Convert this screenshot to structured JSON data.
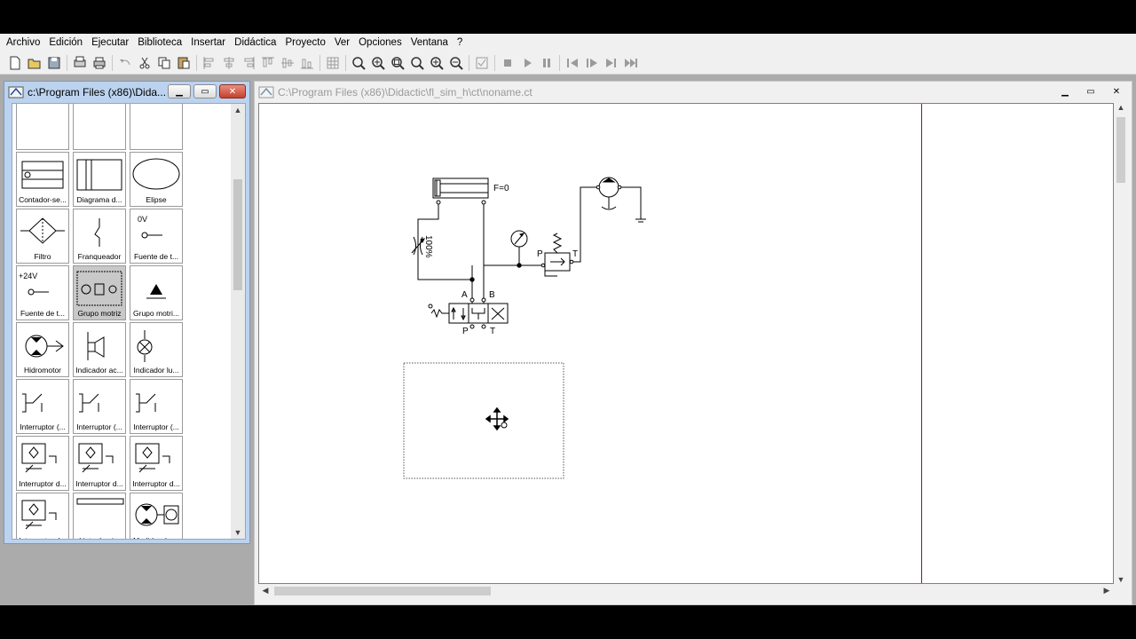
{
  "menu": [
    "Archivo",
    "Edición",
    "Ejecutar",
    "Biblioteca",
    "Insertar",
    "Didáctica",
    "Proyecto",
    "Ver",
    "Opciones",
    "Ventana",
    "?"
  ],
  "library_window": {
    "title": "c:\\Program Files (x86)\\Dida...",
    "items": [
      {
        "label": "Contador-se...",
        "icon": "counter-icon"
      },
      {
        "label": "Diagrama d...",
        "icon": "diagram-icon"
      },
      {
        "label": "Elipse",
        "icon": "ellipse-icon"
      },
      {
        "label": "Filtro",
        "icon": "filter-icon"
      },
      {
        "label": "Franqueador",
        "icon": "jumper-icon"
      },
      {
        "label": "Fuente de t...",
        "icon": "voltage-0v-icon",
        "text": "0V"
      },
      {
        "label": "Fuente de t...",
        "icon": "voltage-24v-icon",
        "text": "+24V"
      },
      {
        "label": "Grupo motriz",
        "icon": "power-unit-icon",
        "selected": true
      },
      {
        "label": "Grupo motri...",
        "icon": "power-unit-compact-icon"
      },
      {
        "label": "Hidromotor",
        "icon": "hydraulic-motor-icon"
      },
      {
        "label": "Indicador ac...",
        "icon": "acoustic-indicator-icon"
      },
      {
        "label": "Indicador lu...",
        "icon": "light-indicator-icon"
      },
      {
        "label": "Interruptor (...",
        "icon": "switch-icon"
      },
      {
        "label": "Interruptor (...",
        "icon": "switch-icon"
      },
      {
        "label": "Interruptor (...",
        "icon": "switch-icon"
      },
      {
        "label": "Interruptor d...",
        "icon": "pressure-switch-icon"
      },
      {
        "label": "Interruptor d...",
        "icon": "pressure-switch-icon"
      },
      {
        "label": "Interruptor d...",
        "icon": "pressure-switch-icon"
      },
      {
        "label": "Interruptor d...",
        "icon": "pressure-switch-icon"
      },
      {
        "label": "Lista de pi...",
        "icon": "parts-list-icon"
      },
      {
        "label": "Medidor de ...",
        "icon": "meter-icon"
      }
    ]
  },
  "document_window": {
    "title": "C:\\Program Files (x86)\\Didactic\\fl_sim_h\\ct\\noname.ct"
  },
  "circuit": {
    "cylinder_label": "F=0",
    "throttle_label": "100%",
    "valve_port_a": "A",
    "valve_port_b": "B",
    "valve_port_p": "P",
    "valve_port_t": "T",
    "relief_port_p": "P",
    "relief_port_t": "T"
  }
}
